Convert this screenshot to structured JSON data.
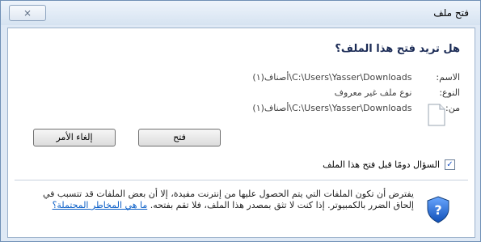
{
  "window": {
    "title": "فتح ملف",
    "close_symbol": "⨯"
  },
  "dialog": {
    "heading": "هل تريد فتح هذا الملف؟",
    "fields": {
      "name_label": "الاسم:",
      "name_value": "C:\\Users\\Yasser\\Downloads\\أصناف(١)",
      "type_label": "النوع:",
      "type_value": "نوع ملف غير معروف",
      "from_label": "من:",
      "from_value": "C:\\Users\\Yasser\\Downloads\\أصناف(١)"
    },
    "buttons": {
      "open": "فتح",
      "cancel": "إلغاء الأمر"
    },
    "checkbox": {
      "label": "السؤال دومًا قبل فتح هذا الملف",
      "checked": true
    },
    "warning": {
      "text": "يفترض أن تكون الملفات التي يتم الحصول عليها من إنترنت مفيدة، إلا أن بعض الملفات قد تتسبب في إلحاق الضرر بالكمبيوتر. إذا كنت لا تثق بمصدر هذا الملف، فلا تقم بفتحه.",
      "link": "ما هي المخاطر المحتملة؟"
    }
  },
  "icons": {
    "file": "file-icon",
    "shield": "shield-icon"
  }
}
